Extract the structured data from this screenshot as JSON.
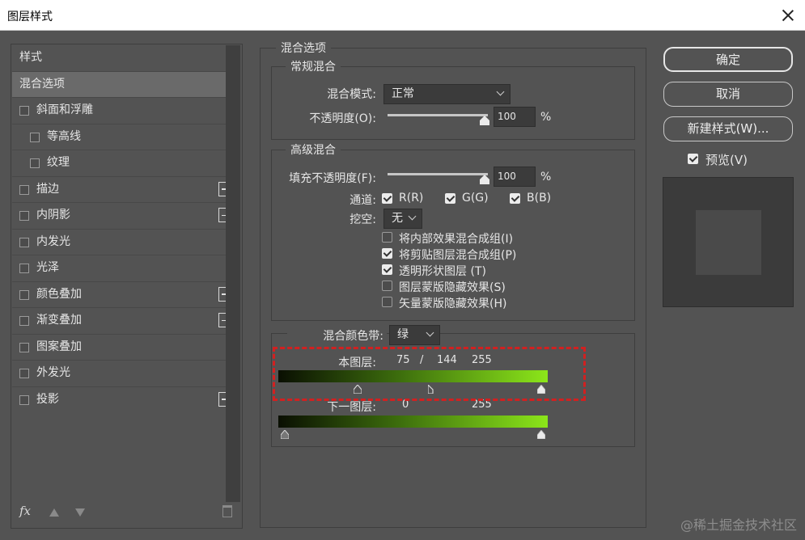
{
  "window": {
    "title": "图层样式"
  },
  "sidebar": {
    "header": "样式",
    "items": [
      {
        "label": "混合选项",
        "selected": true
      },
      {
        "label": "斜面和浮雕",
        "checkbox": true,
        "plus": false
      },
      {
        "label": "等高线",
        "checkbox": true,
        "sub": true
      },
      {
        "label": "纹理",
        "checkbox": true,
        "sub": true
      },
      {
        "label": "描边",
        "checkbox": true,
        "plus": true
      },
      {
        "label": "内阴影",
        "checkbox": true,
        "plus": true
      },
      {
        "label": "内发光",
        "checkbox": true
      },
      {
        "label": "光泽",
        "checkbox": true
      },
      {
        "label": "颜色叠加",
        "checkbox": true,
        "plus": true
      },
      {
        "label": "渐变叠加",
        "checkbox": true,
        "plus": true
      },
      {
        "label": "图案叠加",
        "checkbox": true
      },
      {
        "label": "外发光",
        "checkbox": true
      },
      {
        "label": "投影",
        "checkbox": true,
        "plus": true
      }
    ],
    "footer": {
      "fx_label": "fx"
    }
  },
  "blend": {
    "section_title": "混合选项",
    "general": {
      "title": "常规混合",
      "mode_label": "混合模式:",
      "mode_value": "正常",
      "opacity_label": "不透明度(O):",
      "opacity_value": "100",
      "opacity_unit": "%"
    },
    "advanced": {
      "title": "高级混合",
      "fill_label": "填充不透明度(F):",
      "fill_value": "100",
      "fill_unit": "%",
      "channels_label": "通道:",
      "channel_r": "R(R)",
      "channel_g": "G(G)",
      "channel_b": "B(B)",
      "knockout_label": "挖空:",
      "knockout_value": "无",
      "options": [
        {
          "label": "将内部效果混合成组(I)",
          "checked": false
        },
        {
          "label": "将剪贴图层混合成组(P)",
          "checked": true
        },
        {
          "label": "透明形状图层 (T)",
          "checked": true
        },
        {
          "label": "图层蒙版隐藏效果(S)",
          "checked": false
        },
        {
          "label": "矢量蒙版隐藏效果(H)",
          "checked": false
        }
      ]
    },
    "blend_if": {
      "label": "混合颜色带:",
      "channel": "绿",
      "this_layer_label": "本图层:",
      "this_low": "75",
      "this_sep": "/",
      "this_mid": "144",
      "this_high": "255",
      "underlying_label": "下一图层:",
      "under_low": "0",
      "under_high": "255"
    }
  },
  "buttons": {
    "ok": "确定",
    "cancel": "取消",
    "new_style": "新建样式(W)...",
    "preview_label": "预览(V)"
  },
  "watermark": "@稀土掘金技术社区"
}
